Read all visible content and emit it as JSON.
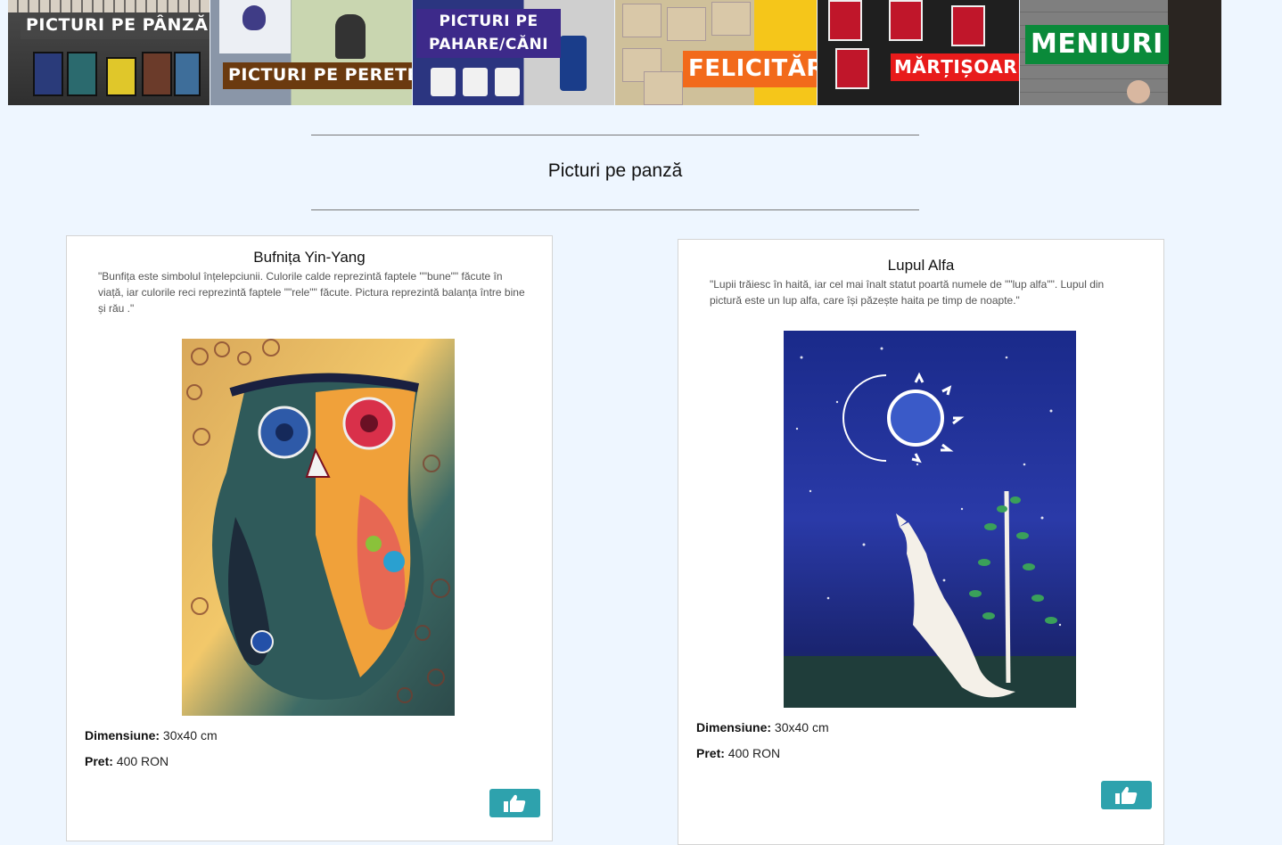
{
  "categories": [
    {
      "label": "PICTURI PE PÂNZĂ"
    },
    {
      "label": "PICTURI PE PERETE"
    },
    {
      "label_line1": "PICTURI PE",
      "label_line2": "PAHARE/CĂNI"
    },
    {
      "label": "FELICITĂRI"
    },
    {
      "label": "MĂRȚIȘOARE"
    },
    {
      "label": "MENIURI"
    }
  ],
  "section": {
    "title": "Picturi pe panză"
  },
  "products": [
    {
      "title": "Bufnița Yin-Yang",
      "description": "\"Bunfița este simbolul înțelepciunii. Culorile calde reprezintă faptele \"\"bune\"\" făcute în viață, iar culorile reci reprezintă faptele \"\"rele\"\" făcute. Pictura reprezintă balanța între bine și rău .\"",
      "dimension_label": "Dimensiune:",
      "dimension_value": "30x40 cm",
      "price_label": "Pret:",
      "price_value": "400 RON",
      "like_icon": "thumbs-up-icon"
    },
    {
      "title": "Lupul Alfa",
      "description": "\"Lupii trăiesc în haită, iar cel mai înalt statut poartă numele de \"\"lup alfa\"\". Lupul din pictură este un lup alfa, care își păzește haita pe timp de noapte.\"",
      "dimension_label": "Dimensiune:",
      "dimension_value": "30x40 cm",
      "price_label": "Pret:",
      "price_value": "400 RON",
      "like_icon": "thumbs-up-icon"
    }
  ],
  "colors": {
    "page_bg": "#eef6ff",
    "like_button": "#2ea2ad"
  }
}
